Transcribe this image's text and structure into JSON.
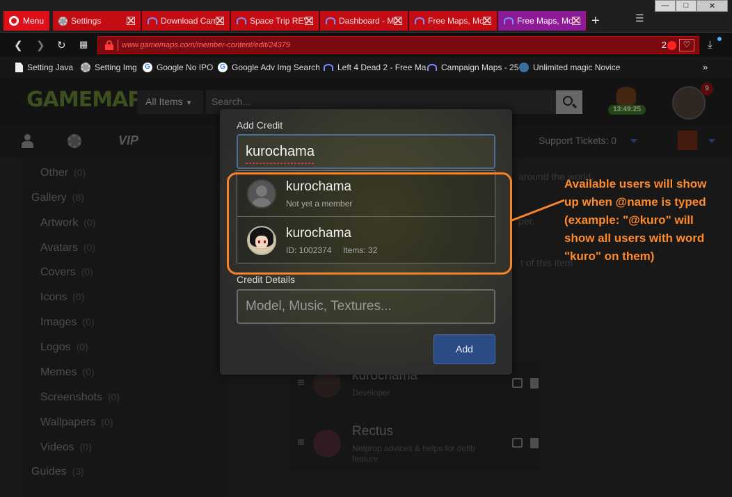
{
  "browser": {
    "menu_label": "Menu",
    "tabs": [
      {
        "label": "Settings"
      },
      {
        "label": "Download Cam"
      },
      {
        "label": "Space Trip REV"
      },
      {
        "label": "Dashboard - Mo"
      },
      {
        "label": "Free Maps, Mo"
      },
      {
        "label": "Free Maps, Mo"
      }
    ],
    "new_tab_symbol": "+",
    "window_controls": {
      "minimize": "—",
      "restore": "□",
      "close": "✕"
    },
    "url": "www.gamemaps.com/member-content/edit/24379",
    "blocked_count": "2",
    "bookmarks": [
      {
        "label": "Setting Java",
        "icon": "page-icon"
      },
      {
        "label": "Setting Img",
        "icon": "gear-icon"
      },
      {
        "label": "Google No IPO",
        "icon": "google-icon"
      },
      {
        "label": "Google Adv Img Search",
        "icon": "google-icon"
      },
      {
        "label": "Left 4 Dead 2 - Free Ma",
        "icon": "gamemaps-icon"
      },
      {
        "label": "Campaign Maps - 25",
        "icon": "gamemaps-icon"
      },
      {
        "label": "Unlimited magic Novice",
        "icon": "globe-icon"
      }
    ],
    "bookmarks_more": "»"
  },
  "site": {
    "logo": "GAMEMAPS",
    "all_items": "All Items",
    "search_placeholder": "Search...",
    "clock": "13:49:25",
    "notifications": "9",
    "vip": "VIP",
    "support_tickets": "Support Tickets: 0",
    "sidebar": [
      {
        "label": "Other",
        "count": "(0)"
      },
      {
        "label": "Gallery",
        "count": "(8)"
      },
      {
        "label": "Artwork",
        "count": "(0)"
      },
      {
        "label": "Avatars",
        "count": "(0)"
      },
      {
        "label": "Covers",
        "count": "(0)"
      },
      {
        "label": "Icons",
        "count": "(0)"
      },
      {
        "label": "Images",
        "count": "(0)"
      },
      {
        "label": "Logos",
        "count": "(0)"
      },
      {
        "label": "Memes",
        "count": "(0)"
      },
      {
        "label": "Screenshots",
        "count": "(0)"
      },
      {
        "label": "Wallpapers",
        "count": "(0)"
      },
      {
        "label": "Videos",
        "count": "(0)"
      },
      {
        "label": "Guides",
        "count": "(3)"
      }
    ],
    "bg_texts": [
      "around the world.",
      "per.",
      "t of this item"
    ],
    "credits": [
      {
        "name": "kurochama",
        "role": "Developer"
      },
      {
        "name": "Rectus",
        "role": "Netprop advices & helps for defib feature"
      }
    ]
  },
  "modal": {
    "add_credit_label": "Add Credit",
    "credit_input_value": "kurochama",
    "suggestions": [
      {
        "name": "kurochama",
        "detail": "Not yet a member"
      },
      {
        "name": "kurochama",
        "detail": "ID: 1002374     Items: 32"
      }
    ],
    "credit_details_label": "Credit Details",
    "credit_details_placeholder": "Model, Music, Textures...",
    "add_button": "Add"
  },
  "annotation": {
    "lines": [
      "Available users will show",
      "up when @name is typed",
      "(example: \"@kuro\" will",
      "show all users with word",
      "\"kuro\" on them)"
    ],
    "color": "#f7832a"
  }
}
